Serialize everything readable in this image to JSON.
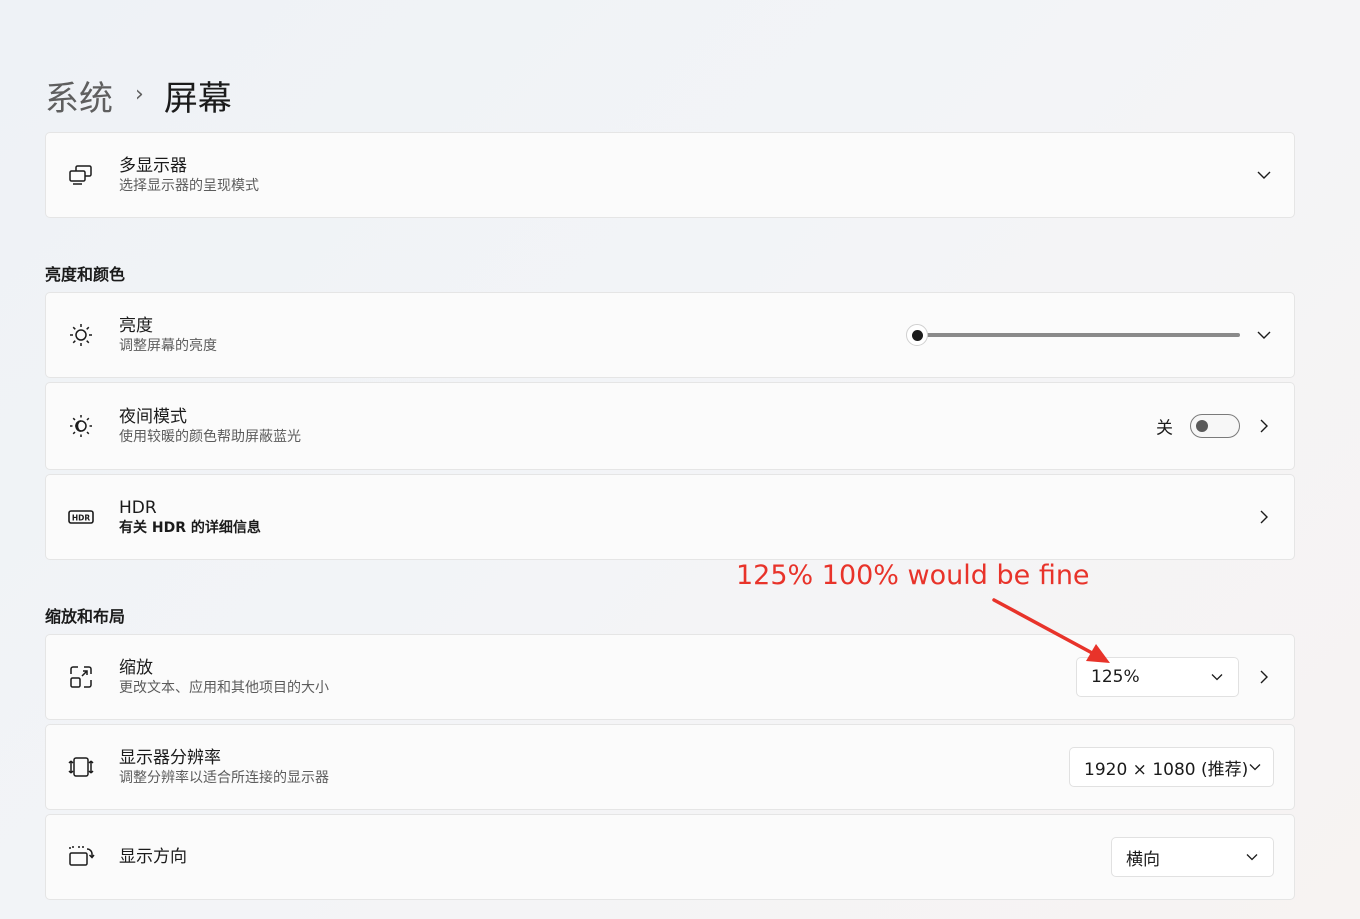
{
  "breadcrumb": {
    "parent": "系统",
    "separator": "›",
    "current": "屏幕"
  },
  "multi_display": {
    "title": "多显示器",
    "desc": "选择显示器的呈现模式",
    "icon": "multi-monitor-icon"
  },
  "section_brightness": {
    "title": "亮度和颜色"
  },
  "brightness": {
    "title": "亮度",
    "desc": "调整屏幕的亮度",
    "icon": "sun-icon",
    "level": 0
  },
  "night_light": {
    "title": "夜间模式",
    "desc": "使用较暖的颜色帮助屏蔽蓝光",
    "icon": "night-light-icon",
    "state_label": "关",
    "on": false
  },
  "hdr": {
    "title": "HDR",
    "desc": "有关 HDR 的详细信息",
    "icon": "hdr-icon"
  },
  "section_scale": {
    "title": "缩放和布局"
  },
  "scale": {
    "title": "缩放",
    "desc": "更改文本、应用和其他项目的大小",
    "icon": "scale-icon",
    "value": "125%"
  },
  "resolution": {
    "title": "显示器分辨率",
    "desc": "调整分辨率以适合所连接的显示器",
    "icon": "resolution-icon",
    "value": "1920 × 1080 (推荐)"
  },
  "orientation": {
    "title": "显示方向",
    "icon": "rotate-screen-icon",
    "value": "横向"
  },
  "annotation": {
    "text": "125% 100% would be fine",
    "color": "#e8332a"
  }
}
